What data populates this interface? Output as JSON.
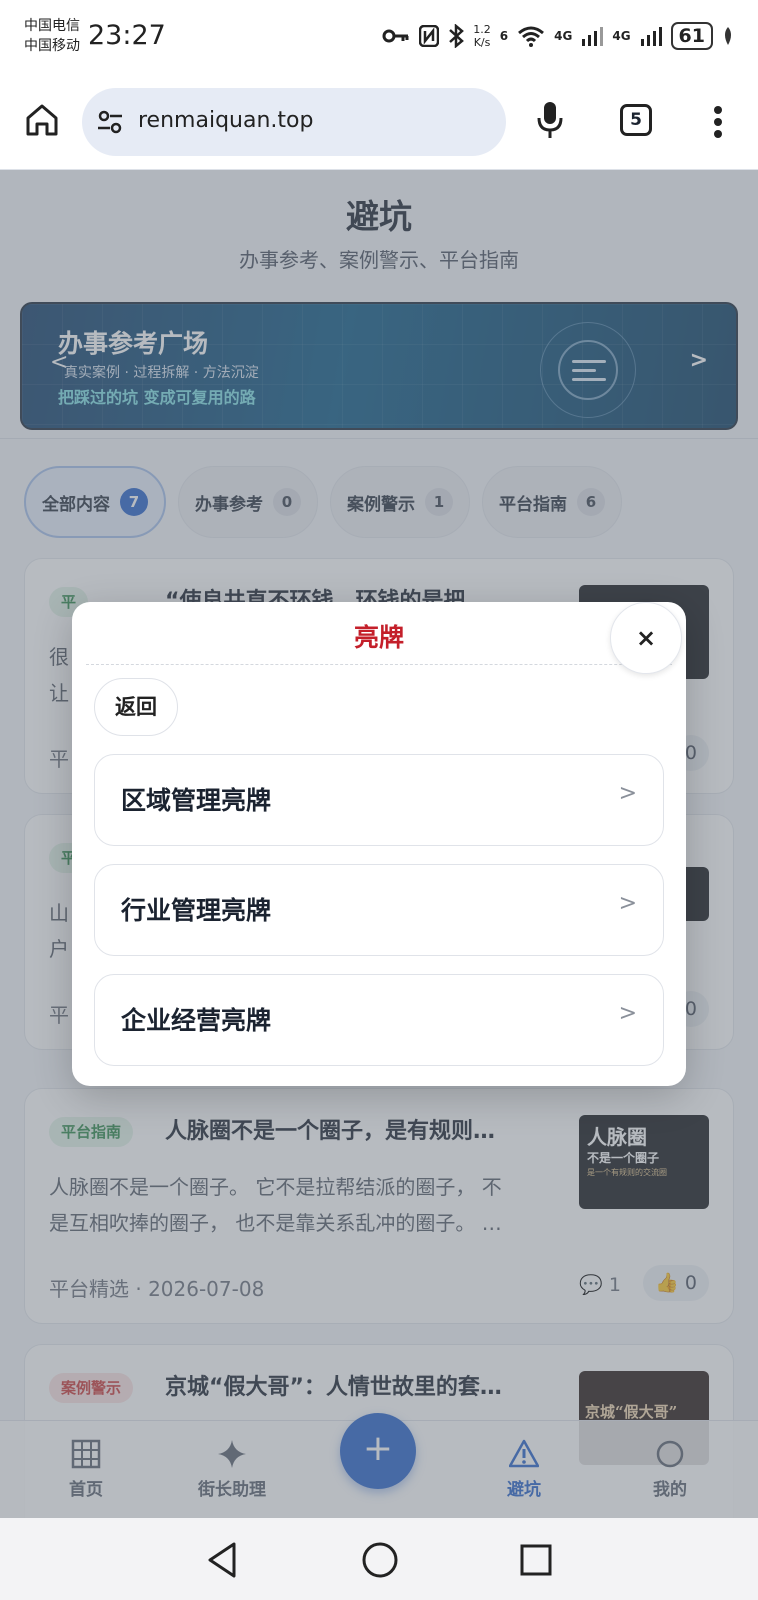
{
  "status": {
    "carrier1": "中国电信",
    "carrier2": "中国移动",
    "time": "23:27",
    "speed_value": "1.2",
    "speed_unit": "K/s",
    "wifi_label": "6",
    "net1": "4G",
    "net2": "4G",
    "battery": "61"
  },
  "browser": {
    "url": "renmaiquan.top",
    "tab_count": "5"
  },
  "page": {
    "title": "避坑",
    "subtitle": "办事参考、案例警示、平台指南"
  },
  "banner": {
    "title": "办事参考广场",
    "subtitle": "真实案例 · 过程拆解 · 方法沉淀",
    "slogan": "把踩过的坑 变成可复用的路",
    "prev": "<",
    "next": ">"
  },
  "filters": [
    {
      "label": "全部内容",
      "count": "7",
      "active": true
    },
    {
      "label": "办事参考",
      "count": "0",
      "active": false
    },
    {
      "label": "案例警示",
      "count": "1",
      "active": false
    },
    {
      "label": "平台指南",
      "count": "6",
      "active": false
    }
  ],
  "cards": [
    {
      "tag": "平",
      "title": "“使良共直不环钱，环钱的是把",
      "body1": "很",
      "body2": "让",
      "meta": "平",
      "likes": "0"
    },
    {
      "tag": "平",
      "title": "",
      "body1": "山",
      "body2": "户",
      "meta": "平",
      "likes": "0"
    },
    {
      "tag": "平台指南",
      "title": "人脉圈不是一个圈子，是有规则…",
      "body1": "人脉圈不是一个圈子。 它不是拉帮结派的圈子， 不",
      "body2": "是互相吹捧的圈子， 也不是靠关系乱冲的圈子。 …",
      "meta": "平台精选 · 2026-07-08",
      "comments": "1",
      "likes": "0",
      "thumb_line1": "人脉圈",
      "thumb_line2": "不是一个圈子",
      "thumb_line3": "是一个有规则的交流圈"
    },
    {
      "tag": "案例警示",
      "title": "京城“假大哥”：人情世故里的套…",
      "thumb_text": "京城“假大哥”"
    }
  ],
  "nav": {
    "home": "首页",
    "assistant": "街长助理",
    "fab": "+",
    "avoid": "避坑",
    "mine": "我的"
  },
  "modal": {
    "title": "亮牌",
    "close": "×",
    "back": "返回",
    "options": [
      {
        "label": "区域管理亮牌",
        "arrow": ">"
      },
      {
        "label": "行业管理亮牌",
        "arrow": ">"
      },
      {
        "label": "企业经营亮牌",
        "arrow": ">"
      }
    ]
  },
  "colors": {
    "accent": "#2a64cc",
    "modal_title": "#c41f2a",
    "guide_tag": "#2f8a4c",
    "warn_tag": "#cc3b3b"
  }
}
